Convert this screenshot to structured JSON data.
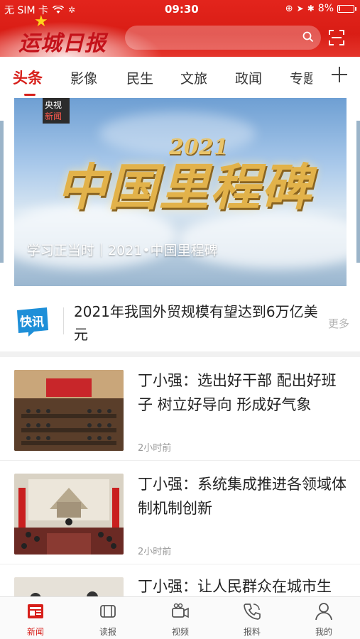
{
  "status_bar": {
    "carrier": "无 SIM 卡",
    "time": "09:30",
    "battery": "8%",
    "battery_level": 0.08
  },
  "header": {
    "app_name": "运城日报",
    "search_placeholder": ""
  },
  "tabs": {
    "items": [
      "头条",
      "影像",
      "民生",
      "文旅",
      "政闻",
      "专题"
    ],
    "active_index": 0
  },
  "banner": {
    "badge_top": "央视",
    "badge_bottom": "新闻",
    "title_year": "2021",
    "title_main": "中国里程碑",
    "caption": "学习正当时｜2021•中国里程碑"
  },
  "flash_news": {
    "icon_label": "快讯",
    "text": "2021年我国外贸规模有望达到6万亿美元",
    "more": "更多"
  },
  "news": [
    {
      "title": "丁小强：选出好干部 配出好班子 树立好导向 形成好气象",
      "time": "2小时前"
    },
    {
      "title": "丁小强：系统集成推进各领域体制机制创新",
      "time": "2小时前"
    },
    {
      "title": "丁小强：让人民群众在城市生",
      "time": ""
    }
  ],
  "tabbar": {
    "items": [
      {
        "label": "新闻",
        "icon": "news-icon"
      },
      {
        "label": "读报",
        "icon": "newspaper-icon"
      },
      {
        "label": "视频",
        "icon": "video-icon"
      },
      {
        "label": "报料",
        "icon": "phone-icon"
      },
      {
        "label": "我的",
        "icon": "user-icon"
      }
    ],
    "active_index": 0
  },
  "colors": {
    "brand_red": "#d71f1a",
    "header_red": "#e3241c"
  }
}
